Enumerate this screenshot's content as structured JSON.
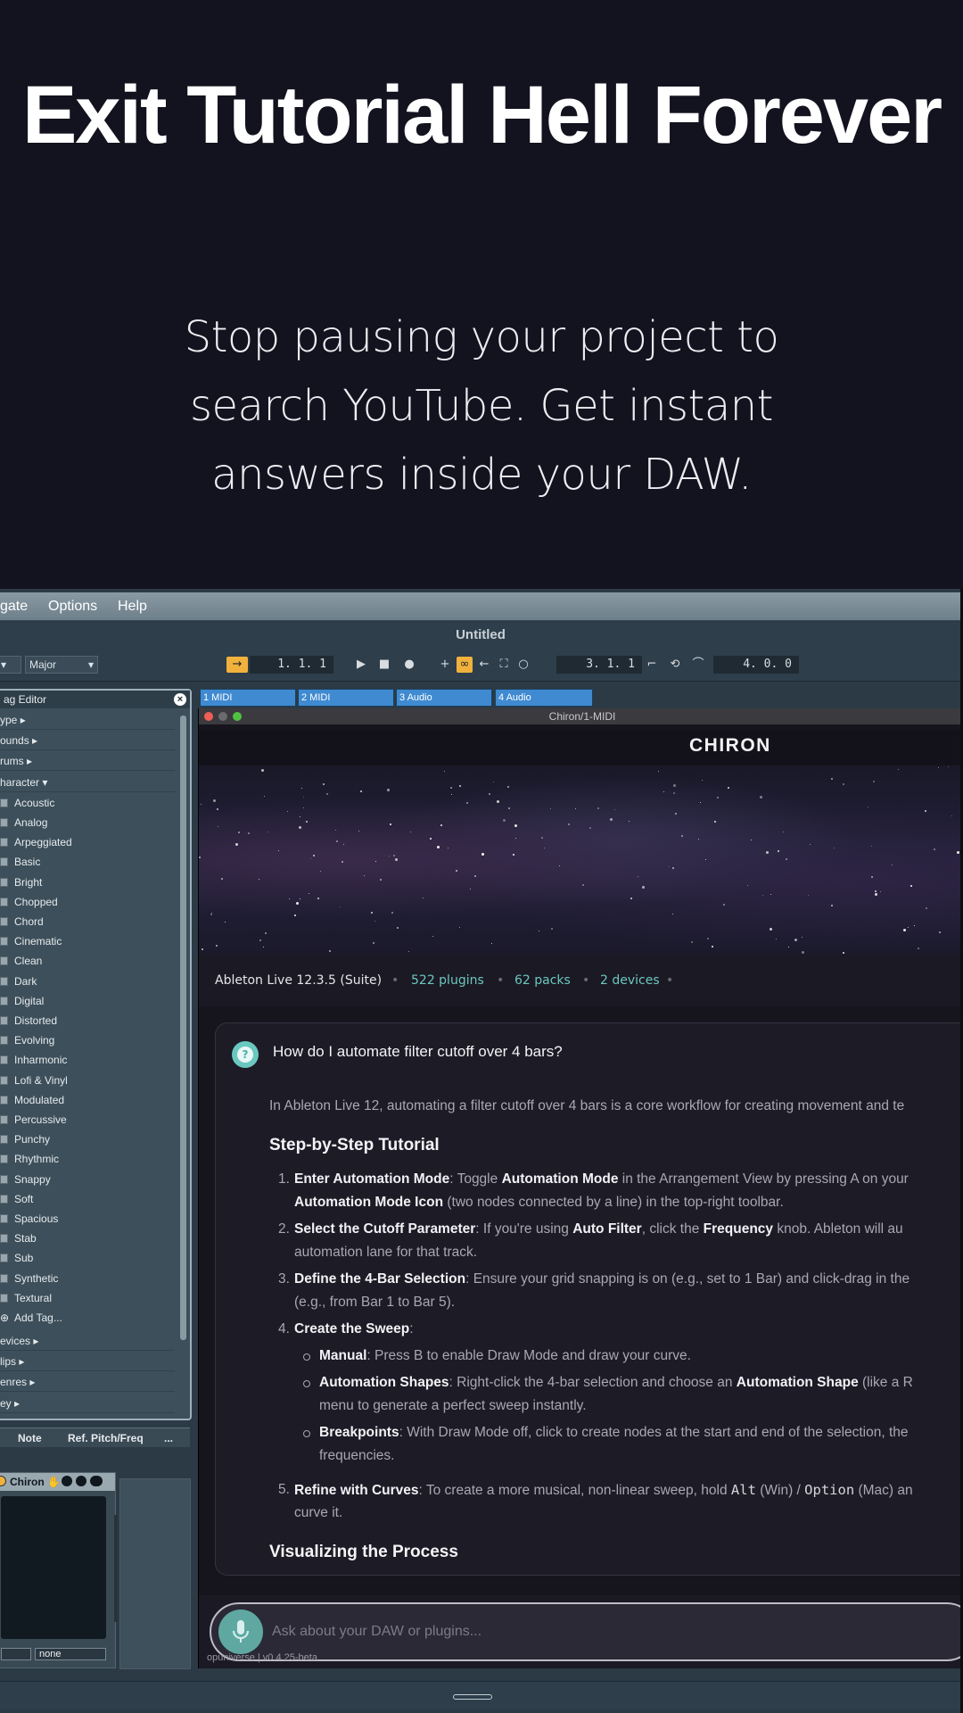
{
  "hero": {
    "title": "Exit Tutorial Hell Forever",
    "subtitle": "Stop pausing your project to search YouTube. Get instant answers inside your DAW."
  },
  "menu": [
    "gate",
    "Options",
    "Help"
  ],
  "window_title": "Untitled",
  "control": {
    "scale": "Major",
    "position": "1.  1.  1",
    "loop_start": "3.  1.  1",
    "loop_length": "4.  0.  0"
  },
  "browser": {
    "title": "ag Editor",
    "categories_top": [
      "ype",
      "ounds",
      "rums",
      "haracter"
    ],
    "tags": [
      "Acoustic",
      "Analog",
      "Arpeggiated",
      "Basic",
      "Bright",
      "Chopped",
      "Chord",
      "Cinematic",
      "Clean",
      "Dark",
      "Digital",
      "Distorted",
      "Evolving",
      "Inharmonic",
      "Lofi & Vinyl",
      "Modulated",
      "Percussive",
      "Punchy",
      "Rhythmic",
      "Snappy",
      "Soft",
      "Spacious",
      "Stab",
      "Sub",
      "Synthetic",
      "Textural"
    ],
    "add_tag": "Add Tag...",
    "categories_bottom": [
      "evices",
      "lips",
      "enres",
      "ey"
    ]
  },
  "notebar": {
    "col1": "e",
    "col2": "Note",
    "col3": "Ref. Pitch/Freq",
    "more": "..."
  },
  "device": {
    "name": "Chiron",
    "value": "none"
  },
  "clips": [
    "1 MIDI",
    "2 MIDI",
    "3 Audio",
    "4 Audio"
  ],
  "plugin": {
    "window_title": "Chiron/1-MIDI",
    "logo": "CHIRON",
    "status": {
      "daw": "Ableton Live 12.3.5 (Suite)",
      "plugins": "522 plugins",
      "packs": "62 packs",
      "devices": "2 devices"
    },
    "question": "How do I automate filter cutoff over 4 bars?",
    "intro": "In Ableton Live 12, automating a filter cutoff over 4 bars is a core workflow for creating movement and te",
    "heading1": "Step-by-Step Tutorial",
    "steps": [
      {
        "n": "1.",
        "title": "Enter Automation Mode",
        "a": ": Toggle ",
        "b": "Automation Mode",
        "c": " in the Arrangement View by pressing A on your",
        "l2a": "Automation Mode Icon",
        "l2b": " (two nodes connected by a line) in the top-right toolbar."
      },
      {
        "n": "2.",
        "title": "Select the Cutoff Parameter",
        "a": ": If you're using ",
        "b": "Auto Filter",
        "c": ", click the ",
        "d": "Frequency",
        "e": " knob. Ableton will au",
        "l2": "automation lane for that track."
      },
      {
        "n": "3.",
        "title": "Define the 4-Bar Selection",
        "a": ": Ensure your grid snapping is on (e.g., set to 1 Bar) and click-drag in the",
        "l2": "(e.g., from Bar 1 to Bar 5)."
      },
      {
        "n": "4.",
        "title": "Create the Sweep",
        "a": ":"
      },
      {
        "n": "5.",
        "title": "Refine with Curves",
        "a": ": To create a more musical, non-linear sweep, hold ",
        "k1": "Alt",
        "m": " (Win) / ",
        "k2": "Option",
        "z": " (Mac) an",
        "l2": "curve it."
      }
    ],
    "bullets": [
      {
        "title": "Manual",
        "text": ": Press B to enable Draw Mode and draw your curve."
      },
      {
        "title": "Automation Shapes",
        "text": ": Right-click the 4-bar selection and choose an ",
        "b": "Automation Shape",
        "c": " (like a R",
        "l2": "menu to generate a perfect sweep instantly."
      },
      {
        "title": "Breakpoints",
        "text": ": With Draw Mode off, click to create nodes at the start and end of the selection, the",
        "l2": "frequencies."
      }
    ],
    "heading2": "Visualizing the Process",
    "input_placeholder": "Ask about your DAW or plugins...",
    "version": "opuniverse | v0.4.25-beta"
  },
  "colors": {
    "accent_teal": "#6ac8c0",
    "clip_blue": "#3f8ad1",
    "transport_orange": "#f0b23c"
  }
}
